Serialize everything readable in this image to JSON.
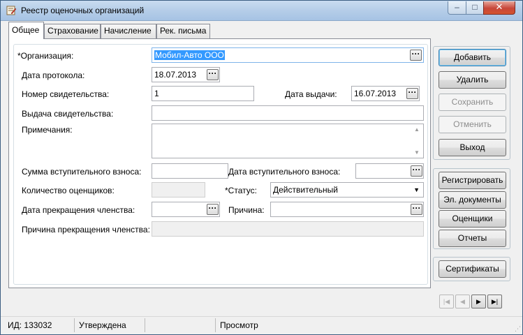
{
  "window": {
    "title": "Реестр оценочных организаций",
    "controls": {
      "minimize": "–",
      "maximize": "□",
      "close": "✕"
    }
  },
  "tabs": [
    "Общее",
    "Страхование",
    "Начисление",
    "Рек. письма"
  ],
  "form": {
    "organization": {
      "label": "*Организация:",
      "value": "Мобил-Авто ООО"
    },
    "protocol_date": {
      "label": "Дата протокола:",
      "value": "18.07.2013"
    },
    "certificate_number": {
      "label": "Номер свидетельства:",
      "value": "1"
    },
    "issue_date": {
      "label": "Дата выдачи:",
      "value": "16.07.2013"
    },
    "certificate_issue": {
      "label": "Выдача свидетельства:",
      "value": ""
    },
    "notes": {
      "label": "Примечания:",
      "value": ""
    },
    "entry_fee": {
      "label": "Сумма вступительного взноса:",
      "value": ""
    },
    "entry_fee_date": {
      "label": "Дата вступительного взноса:",
      "value": ""
    },
    "appraisers_count": {
      "label": "Количество оценщиков:",
      "value": ""
    },
    "status": {
      "label": "*Статус:",
      "value": "Действительный"
    },
    "termination_date": {
      "label": "Дата прекращения членства:",
      "value": ""
    },
    "reason": {
      "label": "Причина:",
      "value": ""
    },
    "termination_reason": {
      "label": "Причина прекращения членства:",
      "value": ""
    }
  },
  "actions": {
    "add": "Добавить",
    "delete": "Удалить",
    "save": "Сохранить",
    "cancel": "Отменить",
    "exit": "Выход",
    "register": "Регистрировать",
    "edocs": "Эл. документы",
    "appraisers": "Оценщики",
    "reports": "Отчеты",
    "certificates": "Сертификаты"
  },
  "navigation": {
    "first": "|◀",
    "prev": "◀",
    "next": "▶",
    "last": "▶|"
  },
  "statusbar": {
    "id": "ИД: 133032",
    "state": "Утверждена",
    "empty": "",
    "mode": "Просмотр"
  },
  "icons": {
    "ellipsis": "···",
    "dropdown": "▼",
    "scroll_up": "▲",
    "scroll_down": "▼"
  }
}
